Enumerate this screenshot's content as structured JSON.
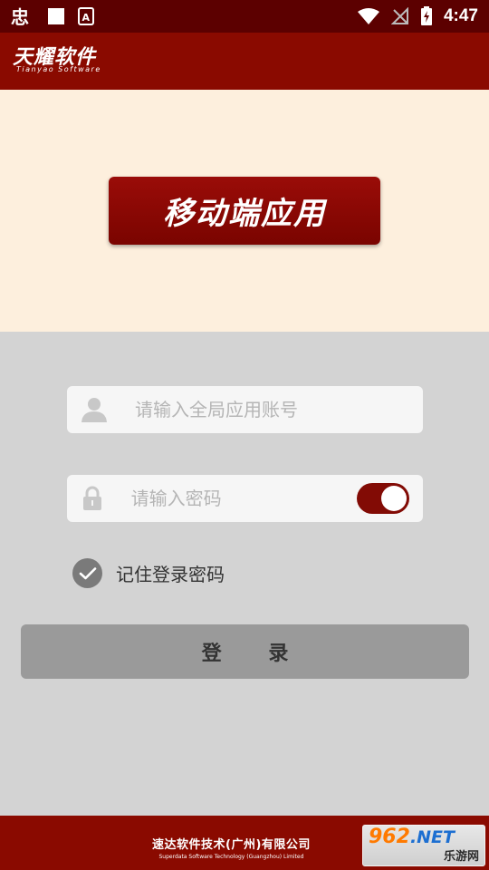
{
  "status_bar": {
    "time": "4:47",
    "icons": [
      "app-icon",
      "square-icon",
      "a-icon",
      "wifi-icon",
      "no-signal-icon",
      "battery-charging-icon"
    ]
  },
  "app_bar": {
    "brand_cn": "天耀软件",
    "brand_en": "Tianyao Software"
  },
  "hero": {
    "badge_text": "移动端应用"
  },
  "login_form": {
    "account_placeholder": "请输入全局应用账号",
    "account_value": "",
    "password_placeholder": "请输入密码",
    "password_value": "",
    "show_password_toggle": true,
    "remember_label": "记住登录密码",
    "remember_checked": true,
    "login_label": "登 录"
  },
  "footer": {
    "company_cn": "速达软件技术(广州)有限公司",
    "company_en": "Superdata Software Technology (Guangzhou) Limited",
    "watermark_top": "962",
    "watermark_net": ".NET",
    "watermark_bottom": "乐游网"
  },
  "colors": {
    "brand_dark_red": "#8a0a00",
    "status_bar": "#5c0000",
    "hero_bg": "#fdefdd",
    "page_bg": "#d3d3d3",
    "button_gray": "#9a9a9a"
  }
}
